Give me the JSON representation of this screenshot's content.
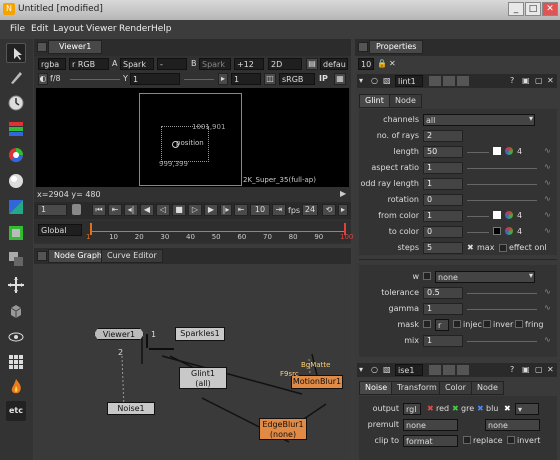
{
  "window": {
    "title": "Untitled [modified]",
    "min": "_",
    "max": "□",
    "close": "✕"
  },
  "menu": [
    "File",
    "Edit",
    "Layout",
    "Viewer",
    "Render",
    "Help"
  ],
  "toolbar": {
    "icons": [
      "pointer-icon",
      "paint-icon",
      "clock-icon",
      "color-bars-icon",
      "color-wheel-icon",
      "sphere-icon",
      "channel-icon",
      "keyer-icon",
      "merge-icon",
      "transform-icon",
      "3d-icon",
      "views-icon",
      "other-icon",
      "furnace-icon",
      "etc-icon"
    ],
    "etc_label": "etc"
  },
  "viewer": {
    "tab": "Viewer1",
    "row1": {
      "channels": "rgba",
      "channel2": "r RGB",
      "a_label": "A",
      "input_a": "Spark",
      "dash": "-",
      "b_label": "B",
      "input_b": "Spark",
      "gain": "+12",
      "mode": "2D",
      "default": "defau"
    },
    "row2": {
      "fstop": "f/8",
      "frame": "1",
      "y_label": "Y",
      "y_value": "1",
      "colorspace": "sRGB",
      "ip": "IP"
    },
    "overlay": {
      "coord_top": "1001,901",
      "coord_bottom": "999,399",
      "label": "position",
      "format": "2K_Super_35(full-ap)"
    },
    "status": "x=2904 y= 480",
    "playback": {
      "frame": "1",
      "step": "10",
      "fps_label": "fps",
      "fps": "24"
    },
    "timeline": {
      "scope": "Global",
      "ticks": [
        "1",
        "10",
        "20",
        "30",
        "40",
        "50",
        "60",
        "70",
        "80",
        "90",
        "100"
      ]
    }
  },
  "nodegraph": {
    "tabs": [
      "Node Graph",
      "Curve Editor"
    ],
    "nodes": {
      "viewer": "Viewer1",
      "sparkles": "Sparkles1",
      "glint": "Glint1",
      "glint_sub": "(all)",
      "noise": "Noise1",
      "motionblur": "MotionBlur1",
      "edgeblur": "EdgeBlur1",
      "edgeblur_sub": "(none)"
    },
    "labels": {
      "one": "1",
      "two": "2",
      "bgmatte": "BgMatte",
      "fgsrc": "F9src"
    }
  },
  "properties": {
    "tab": "Properties",
    "count": "10",
    "glint": {
      "name": "lint1",
      "tabs": [
        "Glint",
        "Node"
      ],
      "rows": [
        {
          "label": "channels",
          "value": "all",
          "kind": "dropdown"
        },
        {
          "label": "no. of rays",
          "value": "2",
          "kind": "num"
        },
        {
          "label": "length",
          "value": "50",
          "kind": "slider",
          "badge": "4"
        },
        {
          "label": "aspect ratio",
          "value": "1",
          "kind": "slider"
        },
        {
          "label": "odd ray length",
          "value": "1",
          "kind": "slider"
        },
        {
          "label": "rotation",
          "value": "0",
          "kind": "slider"
        },
        {
          "label": "from color",
          "value": "1",
          "kind": "color",
          "badge": "4"
        },
        {
          "label": "to color",
          "value": "0",
          "kind": "color",
          "badge": "4"
        },
        {
          "label": "steps",
          "value": "5",
          "kind": "steps",
          "extra1": "max",
          "extra2": "effect onl"
        }
      ],
      "rows2": [
        {
          "label": "w",
          "value": "none",
          "kind": "w"
        },
        {
          "label": "tolerance",
          "value": "0.5",
          "kind": "slider"
        },
        {
          "label": "gamma",
          "value": "1",
          "kind": "slider"
        },
        {
          "label": "mask",
          "kind": "mask",
          "inject": "injec",
          "invert": "inver",
          "fringe": "fring",
          "sub": "r"
        },
        {
          "label": "mix",
          "value": "1",
          "kind": "slider"
        }
      ]
    },
    "noise": {
      "name": "ise1",
      "tabs": [
        "Noise",
        "Transform",
        "Color",
        "Node"
      ],
      "output_label": "output",
      "output": "rgl",
      "ch": [
        "red",
        "gre",
        "blu"
      ],
      "premult_label": "premult",
      "premult": "none",
      "premult2": "none",
      "clip_label": "clip to",
      "clip": "format",
      "replace": "replace",
      "invert": "invert"
    }
  }
}
